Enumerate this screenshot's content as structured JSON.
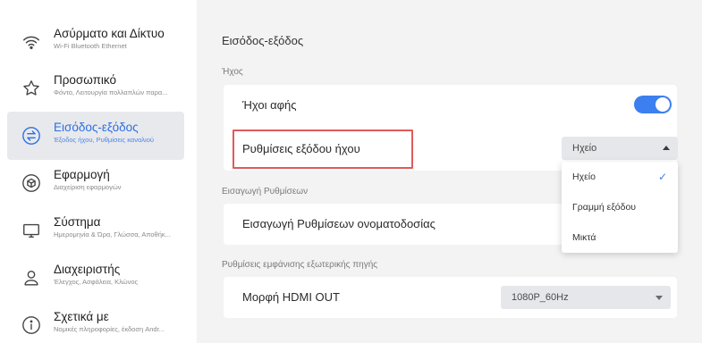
{
  "sidebar": {
    "items": [
      {
        "icon": "wifi-icon",
        "title": "Ασύρματο και Δίκτυο",
        "subtitle": "Wi-Fi Bluetooth Ethernet"
      },
      {
        "icon": "star-icon",
        "title": "Προσωπικό",
        "subtitle": "Φόντο, Λειτουργία πολλαπλών παρα..."
      },
      {
        "icon": "swap-arrows-icon",
        "title": "Εισόδος-εξόδος",
        "subtitle": "Έξοδος ήχου, Ρυθμίσεις καναλιού",
        "active": true
      },
      {
        "icon": "cube-icon",
        "title": "Εφαρμογή",
        "subtitle": "Διαχείριση εφαρμογών"
      },
      {
        "icon": "monitor-icon",
        "title": "Σύστημα",
        "subtitle": "Ημερομηνία & Ώρα, Γλώσσα, Αποθήκ..."
      },
      {
        "icon": "user-icon",
        "title": "Διαχειριστής",
        "subtitle": "Έλεγχος, Ασφάλεια, Κλώνος"
      },
      {
        "icon": "info-icon",
        "title": "Σχετικά με",
        "subtitle": "Νομικές πληροφορίες, έκδοση Andr..."
      }
    ]
  },
  "main": {
    "title": "Εισόδος-εξόδος",
    "sound_section": "Ήχος",
    "touch_sounds_label": "Ήχοι αφής",
    "touch_sounds_on": true,
    "audio_output_label": "Ρυθμίσεις εξόδου ήχου",
    "audio_output_value": "Ηχείο",
    "audio_output_options": [
      {
        "label": "Ηχείο",
        "selected": true
      },
      {
        "label": "Γραμμή εξόδου",
        "selected": false
      },
      {
        "label": "Μικτά",
        "selected": false
      }
    ],
    "import_section": "Εισαγωγή Ρυθμίσεων",
    "import_naming_label": "Εισαγωγή Ρυθμίσεων ονοματοδοσίας",
    "external_section": "Ρυθμίσεις εμφάνισης εξωτερικής πηγής",
    "hdmi_out_label": "Μορφή HDMI OUT",
    "hdmi_out_value": "1080P_60Hz"
  },
  "colors": {
    "accent": "#3b7ff0",
    "active_text": "#2b6fe3",
    "highlight": "#e05a5a"
  }
}
